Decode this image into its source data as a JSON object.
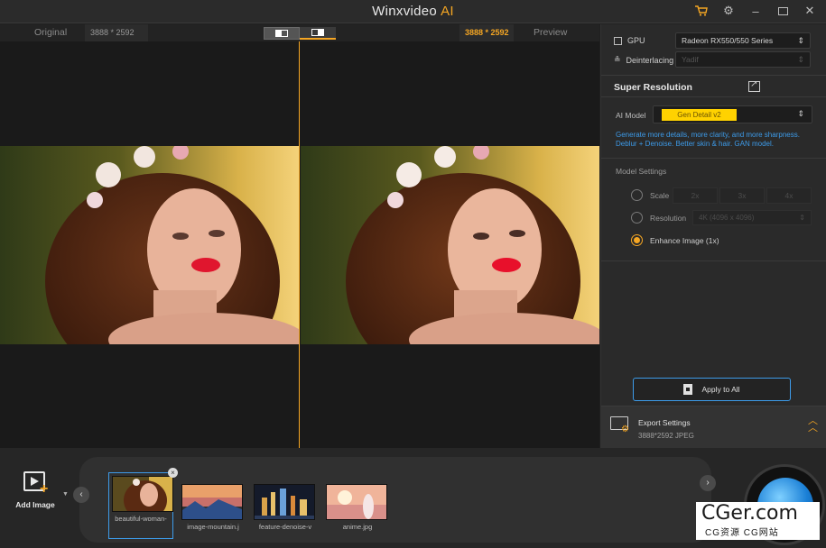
{
  "app": {
    "title": "Winxvideo",
    "title_accent": "AI"
  },
  "titlebar_icons": [
    "cart-icon",
    "gear-icon",
    "minimize-icon",
    "maximize-icon",
    "close-icon"
  ],
  "preview": {
    "original_label": "Original",
    "original_resolution": "3888 * 2592",
    "output_resolution": "3888 * 2592",
    "preview_label": "Preview"
  },
  "panel": {
    "gpu_label": "GPU",
    "gpu_value": "Radeon RX550/550 Series",
    "deinterlacing_label": "Deinterlacing",
    "deinterlacing_value": "Yadif",
    "super_resolution_title": "Super Resolution",
    "ai_model_label": "AI Model",
    "ai_model_value": "Gen Detail v2",
    "ai_model_desc": "Generate more details, more clarity, and more sharpness. Deblur + Denoise. Better skin & hair. GAN model.",
    "model_settings_title": "Model Settings",
    "scale_label": "Scale",
    "scale_options": [
      "2x",
      "3x",
      "4x"
    ],
    "resolution_label": "Resolution",
    "resolution_value": "4K (4096 x 4096)",
    "enhance_label": "Enhance Image (1x)",
    "apply_label": "Apply to All"
  },
  "export": {
    "title": "Export Settings",
    "subtitle": "3888*2592  JPEG"
  },
  "bottom": {
    "add_image_label": "Add Image",
    "thumbnails": [
      {
        "name": "beautiful-woman-",
        "selected": true
      },
      {
        "name": "image-mountain.j",
        "selected": false
      },
      {
        "name": "feature-denoise-v",
        "selected": false
      },
      {
        "name": "anime.jpg",
        "selected": false
      }
    ]
  },
  "watermark": {
    "main": "CGer.com",
    "sub": "CG资源 CG网站"
  },
  "colors": {
    "accent": "#f5a623",
    "link": "#3d9be9",
    "pill": "#ffd200"
  }
}
